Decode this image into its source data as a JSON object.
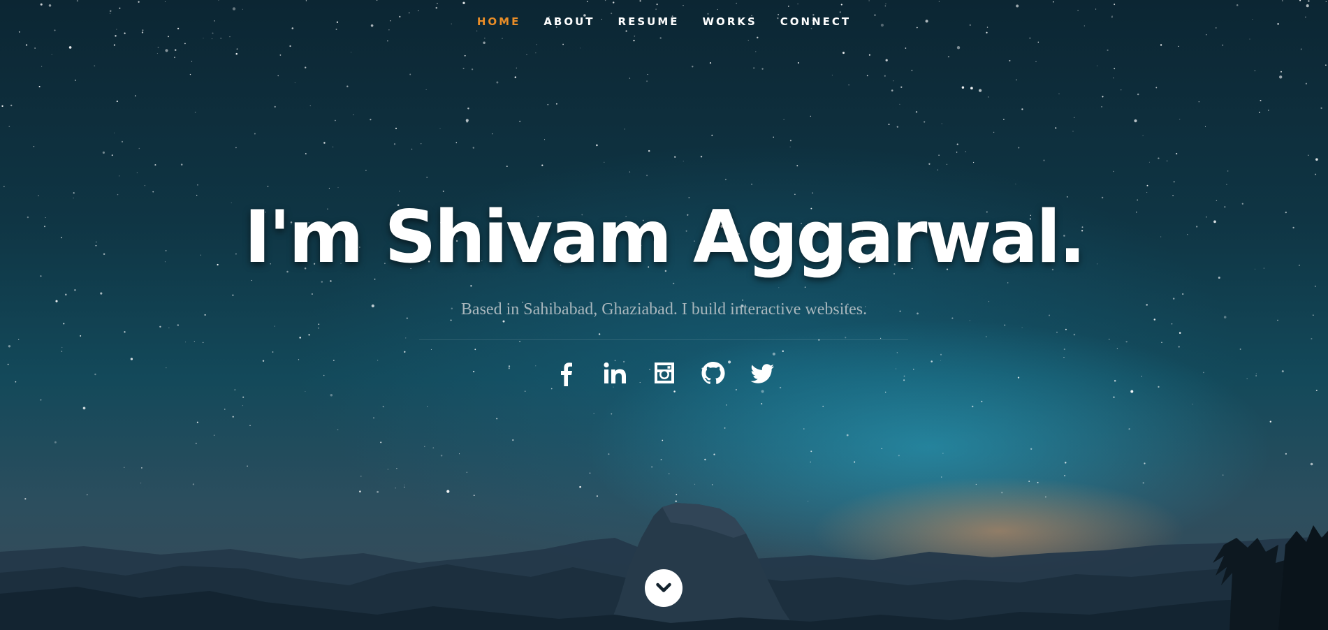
{
  "nav": {
    "items": [
      {
        "label": "HOME",
        "active": true
      },
      {
        "label": "ABOUT",
        "active": false
      },
      {
        "label": "RESUME",
        "active": false
      },
      {
        "label": "WORKS",
        "active": false
      },
      {
        "label": "CONNECT",
        "active": false
      }
    ],
    "active_color": "#e98d27",
    "text_color": "#ffffff"
  },
  "hero": {
    "title": "I'm Shivam Aggarwal.",
    "subtitle": "Based in Sahibabad, Ghaziabad. I build interactive websites."
  },
  "social": [
    {
      "icon": "facebook-icon"
    },
    {
      "icon": "linkedin-icon"
    },
    {
      "icon": "instagram-icon"
    },
    {
      "icon": "github-icon"
    },
    {
      "icon": "twitter-icon"
    }
  ],
  "scroll_button": {
    "icon": "chevron-down-icon"
  }
}
